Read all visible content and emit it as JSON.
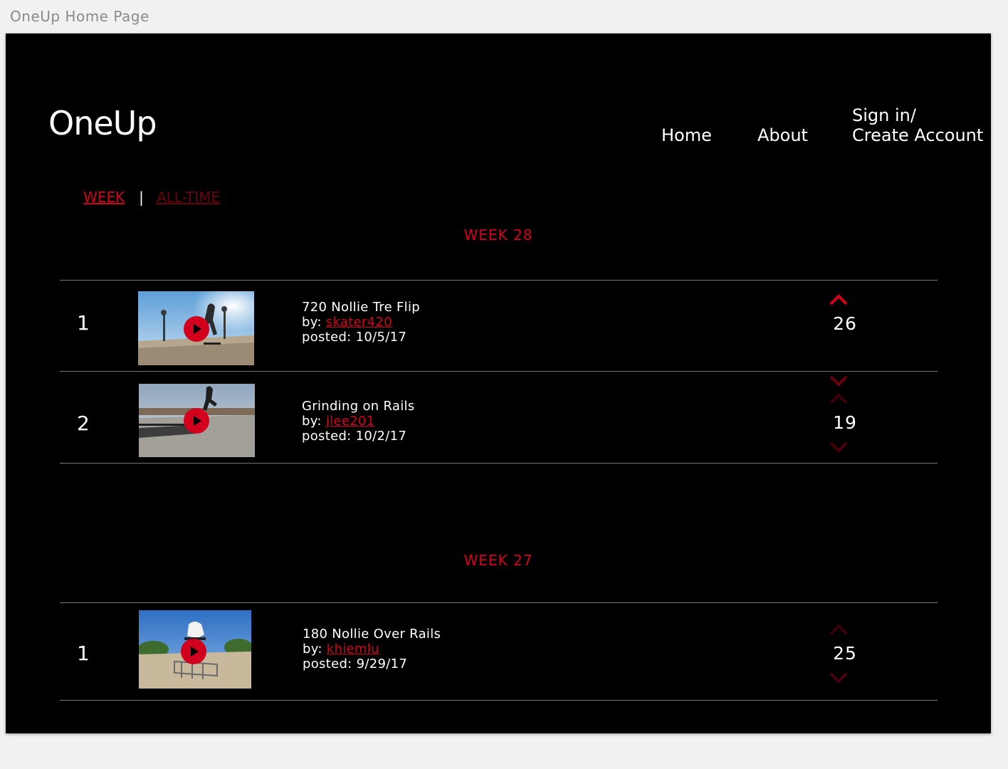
{
  "window_title": "OneUp Home Page",
  "header": {
    "logo": "OneUp",
    "nav": {
      "home": "Home",
      "about": "About",
      "signin_line1": "Sign in/",
      "signin_line2": "Create Account"
    }
  },
  "filters": {
    "week": "WEEK",
    "divider": "|",
    "all_time": "ALL-TIME",
    "active": "week"
  },
  "colors": {
    "accent": "#d2001c",
    "accent_dim": "#6a000e",
    "background": "#000000",
    "text": "#ffffff"
  },
  "sections": [
    {
      "heading": "WEEK 28",
      "entries": [
        {
          "rank": "1",
          "title": "720 Nollie Tre Flip",
          "by_label": "by:",
          "author": "skater420",
          "posted_label": "posted:",
          "posted": "10/5/17",
          "score": "26",
          "vote_state": "upvoted",
          "thumbnail_icon": "play-icon"
        },
        {
          "rank": "2",
          "title": "Grinding on Rails",
          "by_label": "by:",
          "author": "jlee201",
          "posted_label": "posted:",
          "posted": "10/2/17",
          "score": "19",
          "vote_state": "none",
          "thumbnail_icon": "play-icon"
        }
      ]
    },
    {
      "heading": "WEEK 27",
      "entries": [
        {
          "rank": "1",
          "title": "180 Nollie Over Rails",
          "by_label": "by:",
          "author": "khiemlu",
          "posted_label": "posted:",
          "posted": "9/29/17",
          "score": "25",
          "vote_state": "none",
          "thumbnail_icon": "play-icon"
        }
      ]
    }
  ]
}
